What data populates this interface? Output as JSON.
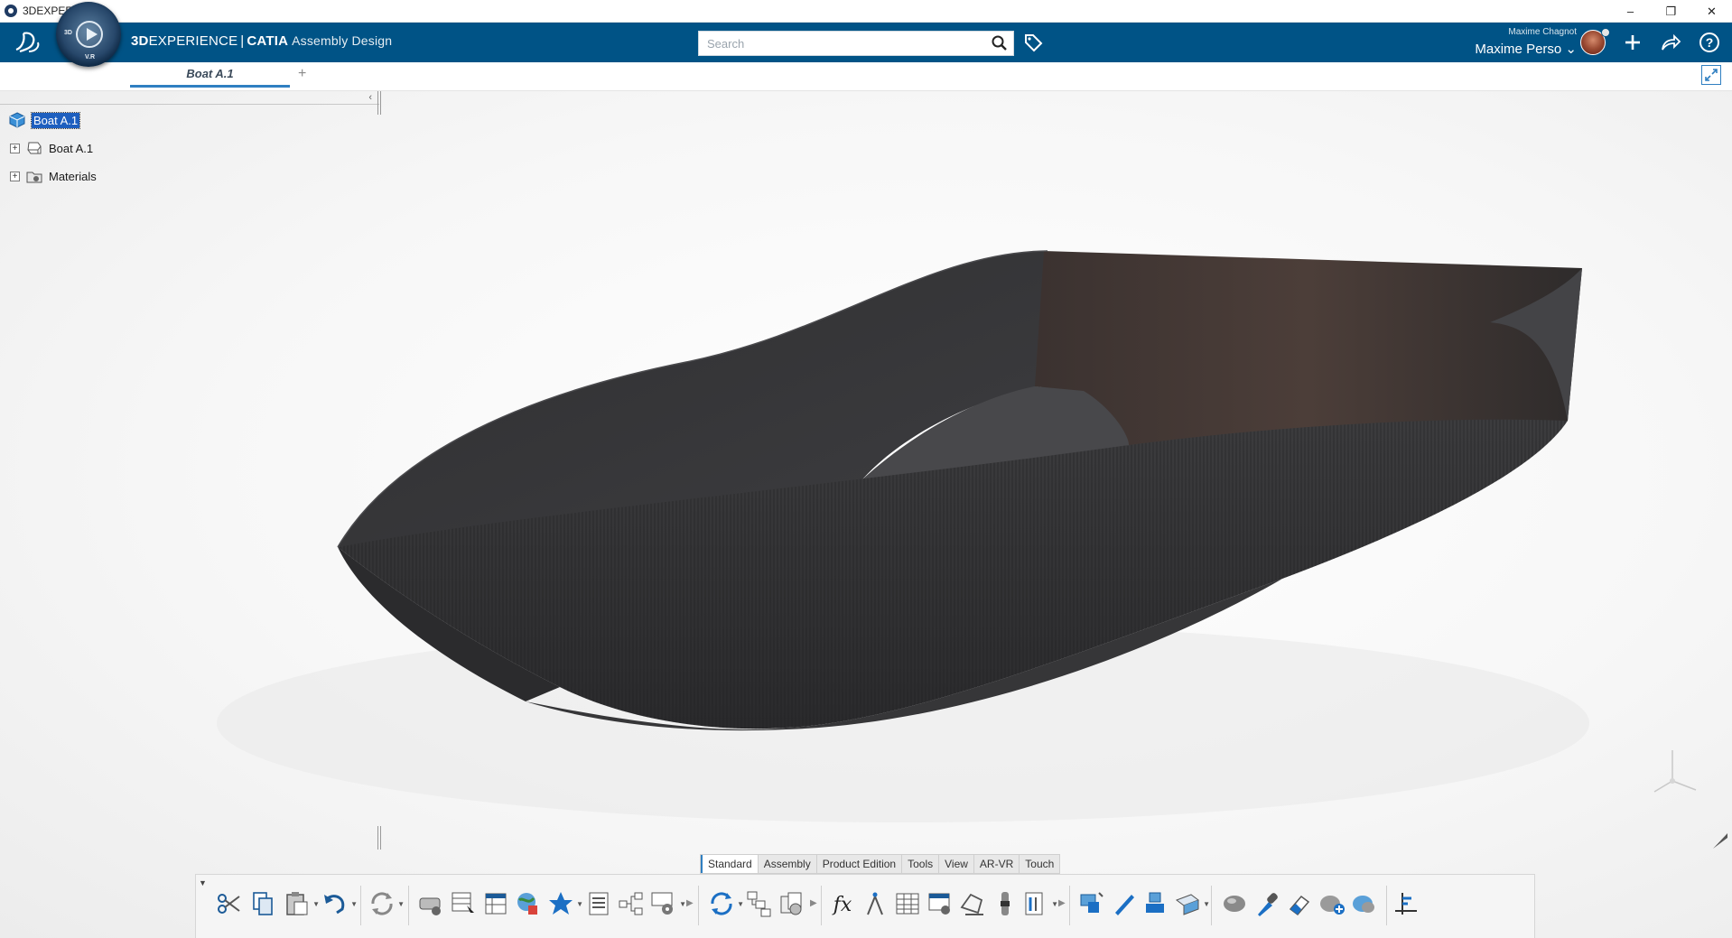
{
  "window": {
    "title": "3DEXPERIENCE",
    "controls": [
      "minimize",
      "restore",
      "close"
    ]
  },
  "header": {
    "brand_bold": "3D",
    "brand_main": "EXPERIENCE",
    "brand_sep": "|",
    "brand_product": "CATIA",
    "brand_app": "Assembly Design",
    "search_placeholder": "Search",
    "user_small": "Maxime Chagnot",
    "user_name": "Maxime Perso",
    "compass_labels": {
      "n": "3D",
      "s": "V.R",
      "e": "",
      "w": ""
    }
  },
  "tabs": {
    "active": "Boat A.1",
    "add": "+"
  },
  "tree": {
    "root": "Boat A.1",
    "children": [
      {
        "label": "Boat A.1",
        "expander": "+"
      },
      {
        "label": "Materials",
        "expander": "+"
      }
    ]
  },
  "action_bar": {
    "tabs": [
      "Standard",
      "Assembly",
      "Product Edition",
      "Tools",
      "View",
      "AR-VR",
      "Touch"
    ],
    "active_tab": "Standard"
  },
  "colors": {
    "header": "#005386",
    "accent": "#2f7fc1",
    "hull": "#3a3a3c",
    "interior": "#4a3e3a"
  }
}
